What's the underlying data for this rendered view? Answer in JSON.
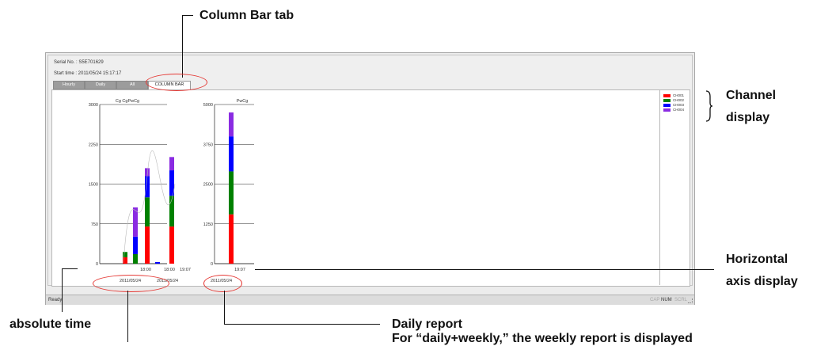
{
  "window": {
    "serial_label": "Serial No. : S5E701629",
    "start_time_label": "Start time : 2011/05/24 15:17:17"
  },
  "tabs": [
    {
      "label": "Hourly",
      "active": false
    },
    {
      "label": "Daily",
      "active": false
    },
    {
      "label": "All",
      "active": false
    },
    {
      "label": "COLUMN BAR",
      "active": true
    }
  ],
  "legend": [
    {
      "label": "CH001",
      "color": "#ff0000"
    },
    {
      "label": "CH002",
      "color": "#008000"
    },
    {
      "label": "CH003",
      "color": "#0000ff"
    },
    {
      "label": "CH004",
      "color": "#8a2be2"
    }
  ],
  "status_bar": {
    "ready": "Ready",
    "cap": "CAP",
    "num": "NUM",
    "scrl": "SCRL"
  },
  "chart_data": [
    {
      "type": "bar",
      "title": "Cg  CgPwCg",
      "ylim": [
        0,
        3000
      ],
      "yticks": [
        "0",
        "750",
        "1500",
        "2250",
        "3000"
      ],
      "xticks": [
        "18:00",
        "18:00",
        "19:07"
      ],
      "date_labels": [
        "2011/05/24",
        "2011/05/24"
      ],
      "series": [
        {
          "name": "CH001",
          "values": [
            120,
            0,
            700,
            0,
            700,
            0
          ]
        },
        {
          "name": "CH002",
          "values": [
            100,
            180,
            550,
            0,
            580,
            0
          ]
        },
        {
          "name": "CH003",
          "values": [
            0,
            330,
            400,
            30,
            480,
            0
          ]
        },
        {
          "name": "CH004",
          "values": [
            0,
            550,
            150,
            0,
            250,
            0
          ]
        }
      ]
    },
    {
      "type": "bar",
      "title": "PwCg",
      "ylim": [
        0,
        5000
      ],
      "yticks": [
        "0",
        "1250",
        "2500",
        "3750",
        "5000"
      ],
      "xticks": [
        "19:07"
      ],
      "date_labels": [
        "2011/05/24"
      ],
      "series": [
        {
          "name": "CH001",
          "values": [
            1550
          ]
        },
        {
          "name": "CH002",
          "values": [
            1350
          ]
        },
        {
          "name": "CH003",
          "values": [
            1100
          ]
        },
        {
          "name": "CH004",
          "values": [
            750
          ]
        }
      ]
    }
  ],
  "callouts": {
    "column_bar_tab": "Column Bar tab",
    "channel_display_1": "Channel",
    "channel_display_2": "display",
    "horizontal_axis_1": "Horizontal",
    "horizontal_axis_2": "axis display",
    "absolute_time": "absolute time",
    "daily_report": "Daily report",
    "daily_weekly_note": "For “daily+weekly,” the weekly report is displayed"
  }
}
